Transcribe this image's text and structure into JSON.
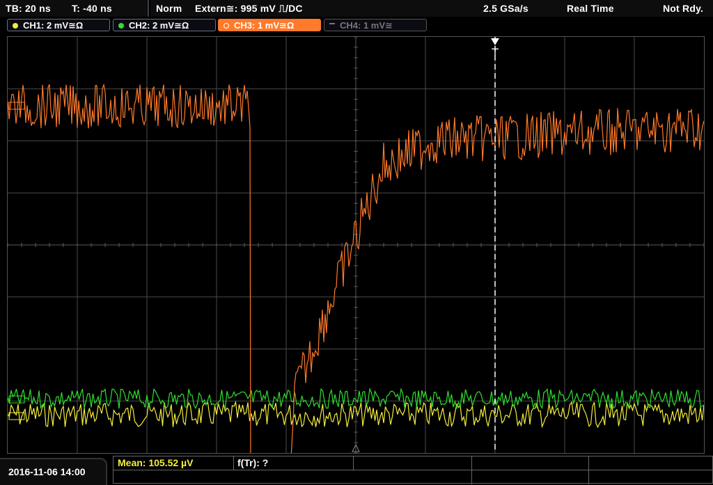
{
  "topbar": {
    "timebase": "TB: 20 ns",
    "trigger_time": "T: -40 ns",
    "mode": "Norm",
    "trigger_source": "Extern≅: 995 mV ⎍/DC",
    "sample_rate": "2.5 GSa/s",
    "acquisition": "Real Time",
    "status": "Not Rdy."
  },
  "channels": [
    {
      "label": "CH1: 2 mV≅Ω",
      "color": "#f5ef3c",
      "active": false
    },
    {
      "label": "CH2: 2 mV≅Ω",
      "color": "#2fe02f",
      "active": false
    },
    {
      "label": "CH3: 1 mV≅Ω",
      "color": "#ff7a2a",
      "active": true
    },
    {
      "label": "CH4: 1 mV≅",
      "color": "#777777",
      "active": false
    }
  ],
  "footer": {
    "datetime": "2016-11-06 14:00",
    "measurement_mean": "Mean: 105.52 µV",
    "measurement_f": "f(Tr): ?"
  },
  "colors": {
    "ch1": "#f5ef3c",
    "ch2": "#2fe02f",
    "ch3": "#ff7a2a",
    "grid": "#4a4a4a",
    "trigger_marker": "#ffffff"
  }
}
